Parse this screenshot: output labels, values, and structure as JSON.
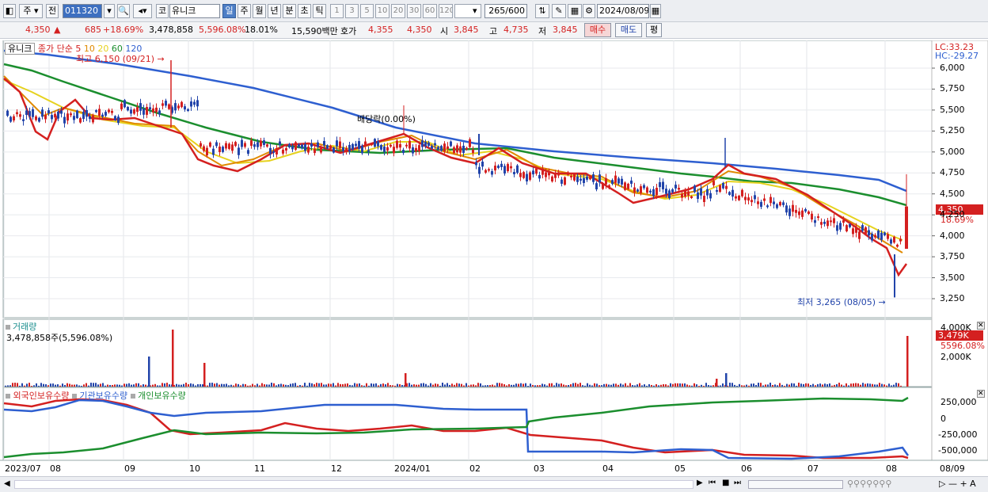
{
  "toolbar": {
    "period_buttons": [
      "일",
      "주",
      "월",
      "년",
      "분",
      "초",
      "틱"
    ],
    "active_period": "일",
    "num_buttons": [
      "1",
      "3",
      "5",
      "10",
      "20",
      "30",
      "60",
      "120"
    ],
    "code_value": "011320",
    "market_prefix": "코",
    "stock_name": "유니크",
    "mode_label": "주",
    "prev_label": "전",
    "count_value": "265",
    "count_max": "/600",
    "date_value": "2024/08/09"
  },
  "info": {
    "price": "4,350",
    "change_arrow": "▲",
    "change": "685",
    "change_pct": "+18.69%",
    "volume": "3,478,858",
    "volume_ratio": "5,596.08%",
    "turnover": "18.01%",
    "amount": "15,590백만",
    "quote_label": "호가",
    "ask": "4,355",
    "bid": "4,350",
    "open_label": "시",
    "open": "3,845",
    "high_label": "고",
    "high": "4,735",
    "low_label": "저",
    "low": "3,845",
    "buy_button": "매수",
    "sell_button": "매도",
    "eval_button": "평"
  },
  "price_panel": {
    "stock_label": "유니크",
    "legend_prefix": "종가 단순",
    "ma_labels": [
      {
        "label": "5",
        "color": "#d42020"
      },
      {
        "label": "10",
        "color": "#e08a00"
      },
      {
        "label": "20",
        "color": "#e6d21e"
      },
      {
        "label": "60",
        "color": "#1b8e2e"
      },
      {
        "label": "120",
        "color": "#2e5fd0"
      }
    ],
    "high_marker": "최고 6,150 (09/21)",
    "low_marker": "최저 3,265 (08/05)",
    "dividend_label": "배당락(0.00%)",
    "lc_label": "LC:33.23",
    "hc_label": "HC:-29.27",
    "y_ticks": [
      "6,000",
      "5,750",
      "5,500",
      "5,250",
      "5,000",
      "4,750",
      "4,500",
      "4,250",
      "4,000",
      "3,750",
      "3,500",
      "3,250"
    ],
    "current_price_tag": "4,350",
    "current_pct_tag": "18.69%"
  },
  "volume_panel": {
    "title": "거래량",
    "value_text": "3,478,858주(5,596.08%)",
    "y_ticks": [
      "4,000K",
      "2,000K"
    ],
    "current_tag": "3,479K",
    "current_pct": "5596.08%"
  },
  "holdings_panel": {
    "series_labels": [
      {
        "label": "외국인보유수량",
        "color": "#d42020"
      },
      {
        "label": "기관보유수량",
        "color": "#2e5fd0"
      },
      {
        "label": "개인보유수량",
        "color": "#1b8e2e"
      }
    ],
    "y_ticks": [
      "250,000",
      "0",
      "-250,000",
      "-500,000"
    ]
  },
  "x_axis": {
    "labels": [
      "2023/07",
      "08",
      "09",
      "10",
      "11",
      "12",
      "2024/01",
      "02",
      "03",
      "04",
      "05",
      "06",
      "07",
      "08"
    ],
    "right_label": "08/09"
  },
  "colors": {
    "up": "#d42020",
    "down": "#2244aa",
    "ma5": "#d42020",
    "ma10": "#e08a00",
    "ma20": "#e6d21e",
    "ma60": "#1b8e2e",
    "ma120": "#2e5fd0"
  }
}
